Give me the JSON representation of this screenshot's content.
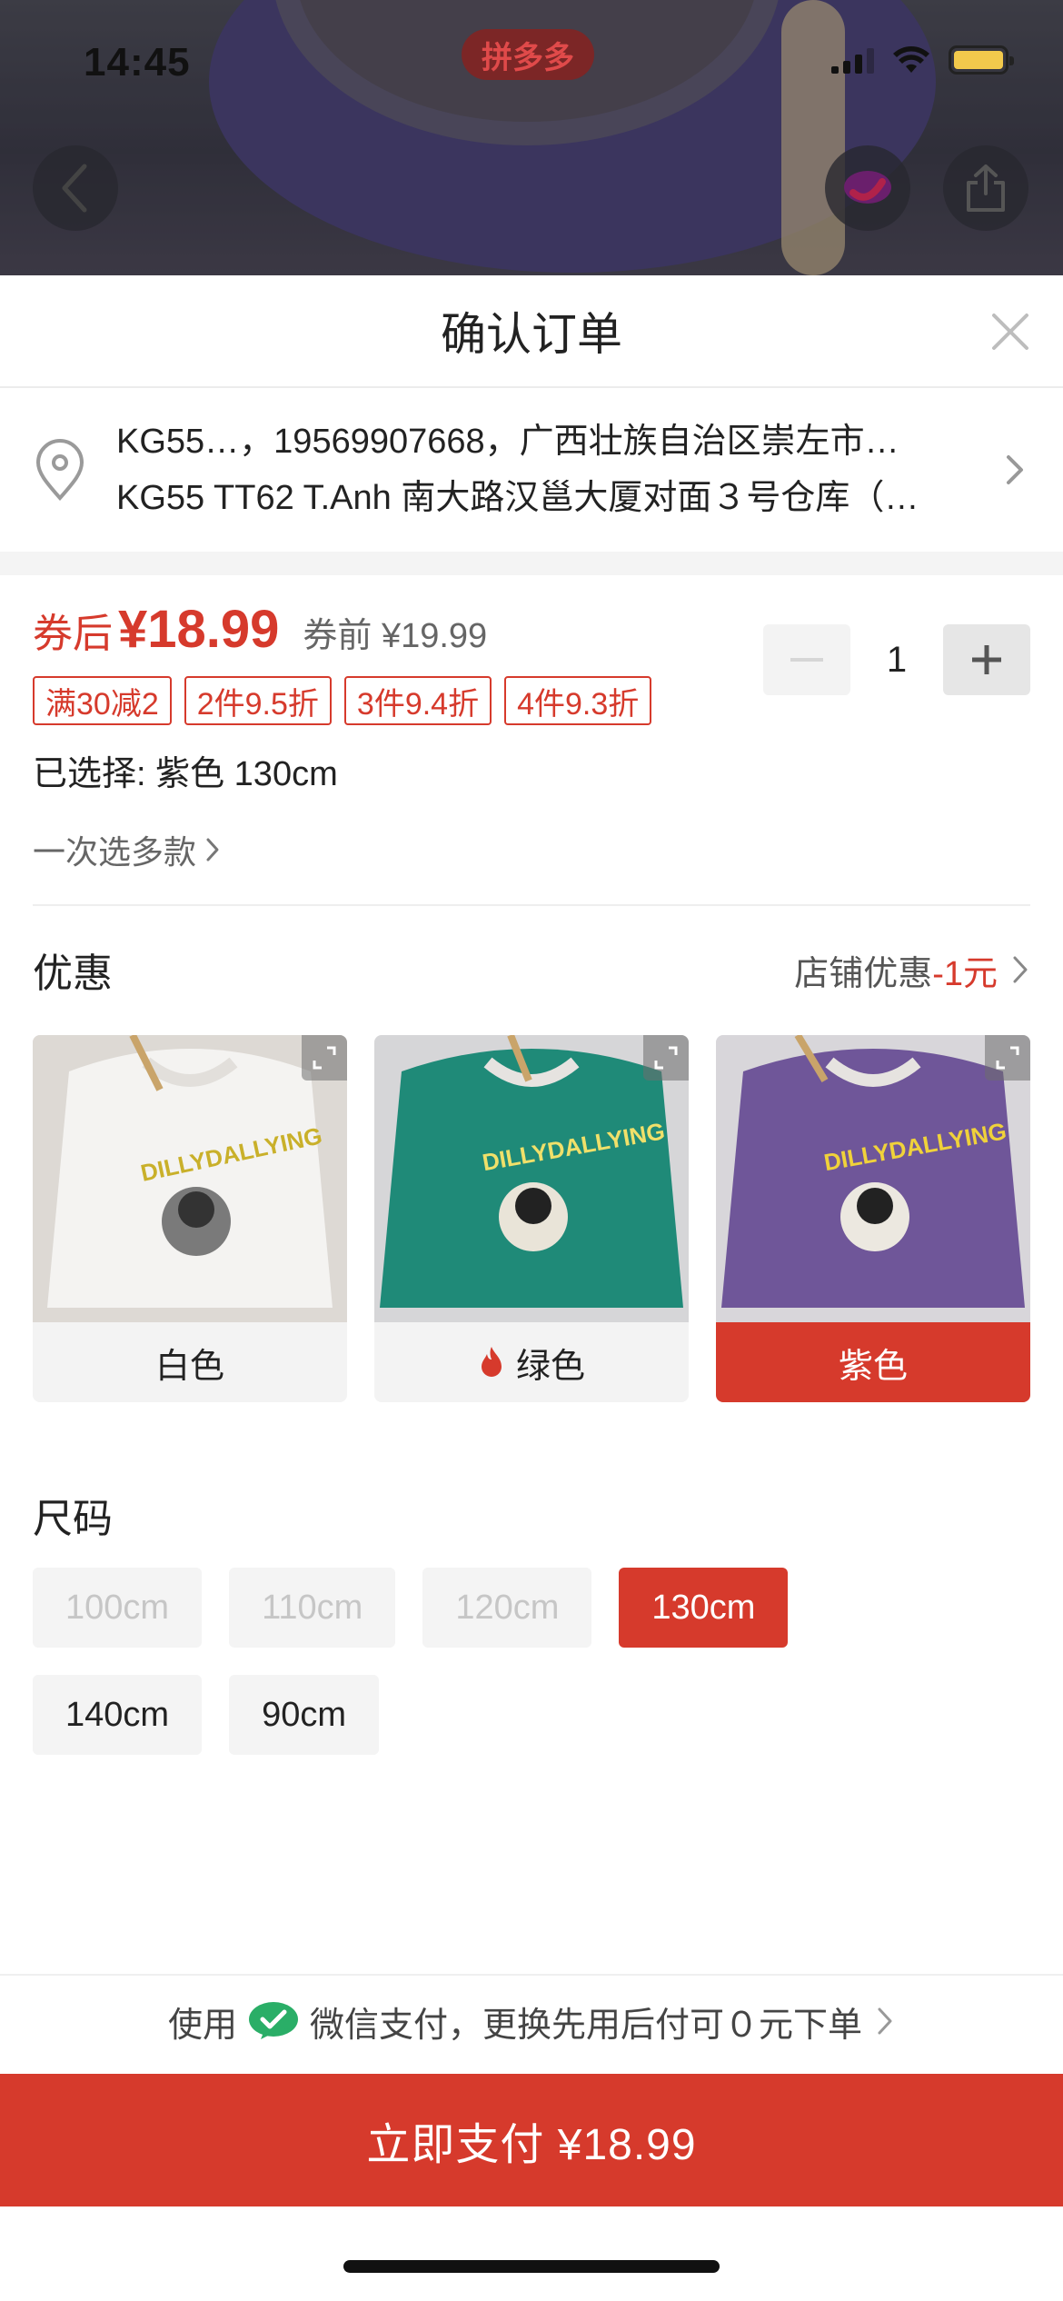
{
  "status": {
    "time": "14:45",
    "app_brand": "拼多多"
  },
  "header": {
    "title": "确认订单"
  },
  "address": {
    "line1": "KG55…，19569907668，广西壮族自治区崇左市…",
    "line2": "KG55 TT62 T.Anh 南大路汉邕大厦对面３号仓库（…"
  },
  "product": {
    "price_after_label": "券后",
    "price_after": "¥18.99",
    "price_before": "券前 ¥19.99",
    "quantity": "1",
    "promos": [
      "满30减2",
      "2件9.5折",
      "3件9.4折",
      "4件9.3折"
    ],
    "selected": "已选择: 紫色 130cm",
    "multi_select": "一次选多款"
  },
  "discount": {
    "title": "优惠",
    "shop_label": "店铺优惠",
    "shop_value": "-1元"
  },
  "colors": [
    {
      "label": "白色",
      "hot": false,
      "selected": false
    },
    {
      "label": "绿色",
      "hot": true,
      "selected": false
    },
    {
      "label": "紫色",
      "hot": false,
      "selected": true
    }
  ],
  "sizes": {
    "title": "尺码",
    "options": [
      {
        "label": "100cm",
        "available": false,
        "selected": false
      },
      {
        "label": "110cm",
        "available": false,
        "selected": false
      },
      {
        "label": "120cm",
        "available": false,
        "selected": false
      },
      {
        "label": "130cm",
        "available": true,
        "selected": true
      },
      {
        "label": "140cm",
        "available": true,
        "selected": false
      },
      {
        "label": "90cm",
        "available": true,
        "selected": false
      }
    ]
  },
  "payment": {
    "prefix": "使用",
    "method": "微信支付，更换先用后付可０元下单",
    "pay_button": "立即支付 ¥18.99"
  },
  "theme": {
    "accent": "#d63a2c",
    "wechat_green": "#2aae67"
  }
}
